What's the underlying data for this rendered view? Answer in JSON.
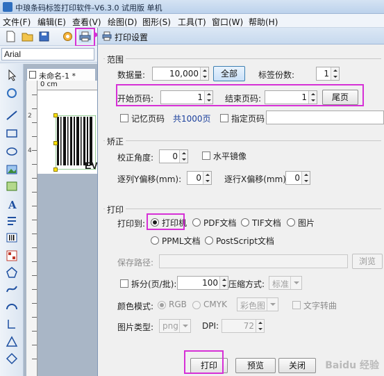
{
  "window": {
    "title": "中琅条码标签打印软件-V6.3.0 试用版 单机"
  },
  "menu": [
    {
      "label": "文件(F)"
    },
    {
      "label": "编辑(E)"
    },
    {
      "label": "查看(V)"
    },
    {
      "label": "绘图(D)"
    },
    {
      "label": "图形(S)"
    },
    {
      "label": "工具(T)"
    },
    {
      "label": "窗口(W)"
    },
    {
      "label": "帮助(H)"
    }
  ],
  "font_select": {
    "value": "Arial"
  },
  "document": {
    "tab_title": "未命名-1 *",
    "ruler_label": "0 cm",
    "ruler_numbers": [
      "2",
      "4"
    ],
    "barcode_text": "EV"
  },
  "dialog": {
    "title": "打印设置",
    "range": {
      "label": "范围",
      "quantity_label": "数据量:",
      "quantity_value": "10,000",
      "all_button": "全部",
      "copies_label": "标签份数:",
      "copies_value": "1",
      "start_page_label": "开始页码:",
      "start_page_value": "1",
      "end_page_label": "结束页码:",
      "end_page_value": "1",
      "last_page_button": "尾页",
      "remember_page_label": "记忆页码",
      "total_pages": "共1000页",
      "specify_page_label": "指定页码"
    },
    "correction": {
      "label": "矫正",
      "angle_label": "校正角度:",
      "angle_value": "0",
      "mirror_label": "水平镜像",
      "y_offset_label": "逐列Y偏移(mm):",
      "y_offset_value": "0",
      "x_offset_label": "逐行X偏移(mm):",
      "x_offset_value": "0"
    },
    "print": {
      "label": "打印",
      "print_to_label": "打印到:",
      "targets": [
        "打印机",
        "PDF文档",
        "TIF文档",
        "图片",
        "PPML文档",
        "PostScript文档"
      ],
      "selected_target": "打印机",
      "save_path_label": "保存路径:",
      "browse_button": "浏览",
      "split_label": "拆分(页/批):",
      "split_value": "100",
      "compress_label": "压缩方式:",
      "compress_value": "标准",
      "color_mode_label": "颜色模式:",
      "color_modes": [
        "RGB",
        "CMYK"
      ],
      "color_select_value": "彩色图",
      "text_convert_label": "文字转曲",
      "image_type_label": "图片类型:",
      "image_type_value": "png",
      "dpi_label": "DPI:",
      "dpi_value": "72"
    },
    "buttons": {
      "print": "打印",
      "preview": "预览",
      "close": "关闭"
    }
  },
  "watermark": "Baidu 经验",
  "colors": {
    "highlight": "#d630d6",
    "accent_blue": "#1a3f9c"
  }
}
